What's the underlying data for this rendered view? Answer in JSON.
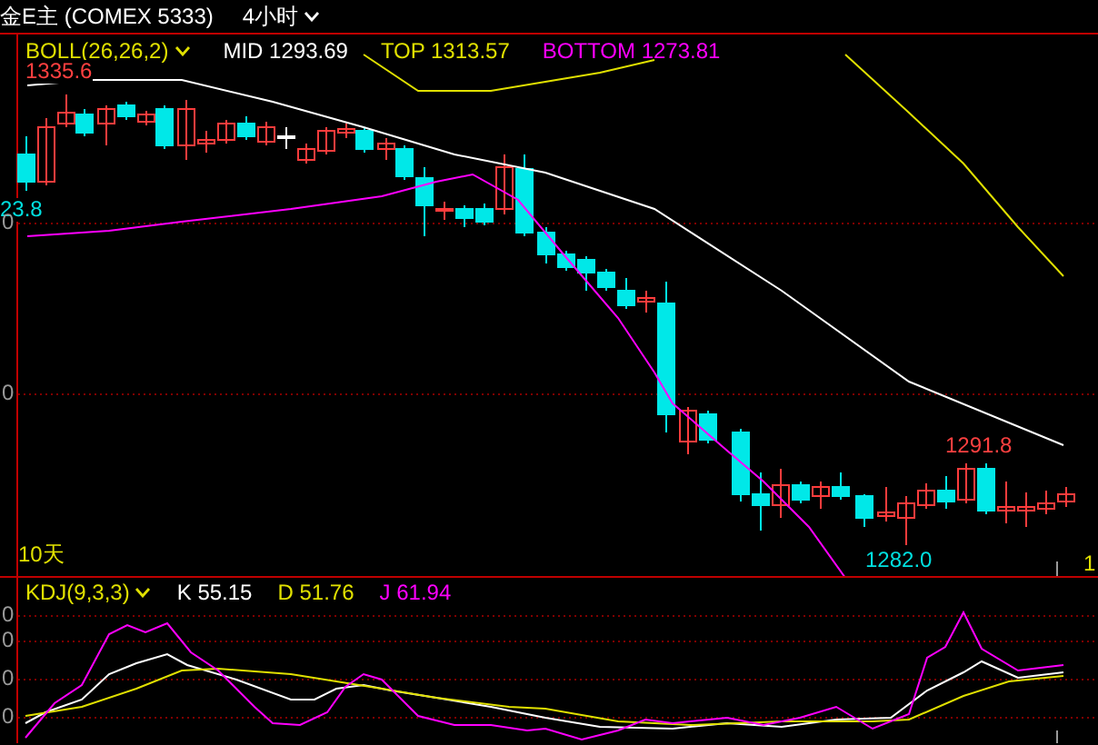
{
  "header": {
    "instrument": "金E主 (COMEX 5333)",
    "period": "4小时"
  },
  "main_panel": {
    "indicator": {
      "label": "BOLL(26,26,2)",
      "color": "#e0e000"
    },
    "legend": [
      {
        "label": "MID 1293.69",
        "color": "#ffffff"
      },
      {
        "label": "TOP 1313.57",
        "color": "#e0e000"
      },
      {
        "label": "BOTTOM 1273.81",
        "color": "#ff00ff"
      }
    ],
    "price_labels": [
      {
        "text": "1335.6",
        "color": "#ff4040"
      },
      {
        "text": "23.8",
        "color": "#00e0e0"
      },
      {
        "text": "1291.8",
        "color": "#ff4040"
      },
      {
        "text": "1282.0",
        "color": "#00e0e0"
      }
    ],
    "axis_labels": [
      "0",
      "0"
    ],
    "period_label": "10天",
    "edge_label": "1"
  },
  "kdj_panel": {
    "indicator": {
      "label": "KDJ(9,3,3)",
      "color": "#e0e000"
    },
    "legend": [
      {
        "label": "K 55.15",
        "color": "#ffffff"
      },
      {
        "label": "D 51.76",
        "color": "#e0e000"
      },
      {
        "label": "J 61.94",
        "color": "#ff00ff"
      }
    ],
    "axis_labels": [
      "0",
      "0",
      "0",
      "0"
    ]
  }
}
